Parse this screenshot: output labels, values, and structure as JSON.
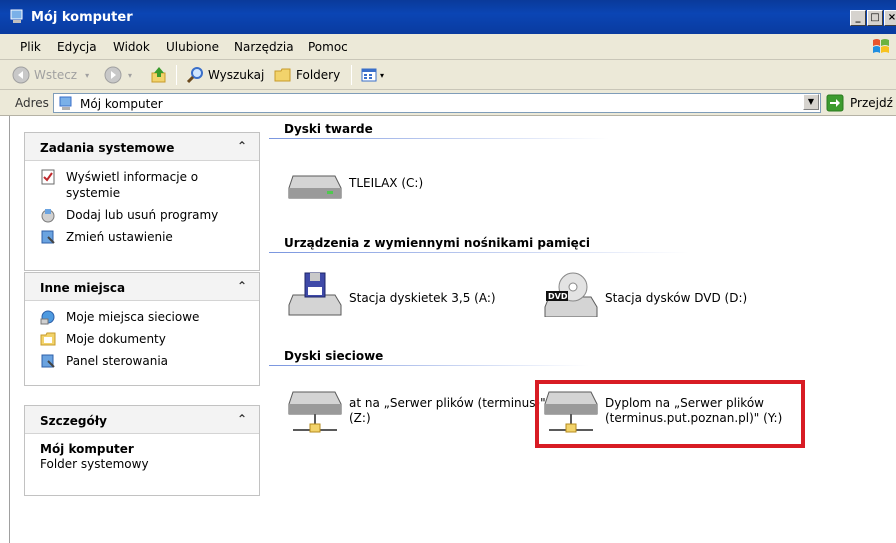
{
  "window": {
    "title": "Mój komputer"
  },
  "menu": [
    "Plik",
    "Edycja",
    "Widok",
    "Ulubione",
    "Narzędzia",
    "Pomoc"
  ],
  "toolbar": {
    "back": "Wstecz",
    "search": "Wyszukaj",
    "folders": "Foldery"
  },
  "address": {
    "label": "Adres",
    "value": "Mój komputer",
    "go": "Przejdź"
  },
  "left": {
    "system_tasks": {
      "title": "Zadania systemowe",
      "items": [
        "Wyświetl informacje o systemie",
        "Dodaj lub usuń programy",
        "Zmień ustawienie"
      ]
    },
    "other_places": {
      "title": "Inne miejsca",
      "items": [
        "Moje miejsca sieciowe",
        "Moje dokumenty",
        "Panel sterowania"
      ]
    },
    "details": {
      "title": "Szczegóły",
      "name": "Mój komputer",
      "type": "Folder systemowy"
    }
  },
  "sections": {
    "hard_drives": {
      "title": "Dyski twarde",
      "items": [
        "TLEILAX (C:)"
      ]
    },
    "removable": {
      "title": "Urządzenia z wymiennymi nośnikami pamięci",
      "items": [
        "Stacja dyskietek 3,5 (A:)",
        "Stacja dysków DVD (D:)"
      ]
    },
    "network": {
      "title": "Dyski sieciowe",
      "items": [
        {
          "line1": "at na „Serwer plików (terminus)\"",
          "line2": "(Z:)"
        },
        {
          "line1": "Dyplom na „Serwer plików",
          "line2": "(terminus.put.poznan.pl)\" (Y:)"
        }
      ]
    }
  },
  "colors": {
    "titlebar": "#0b45b4",
    "highlight": "#d81c24"
  }
}
